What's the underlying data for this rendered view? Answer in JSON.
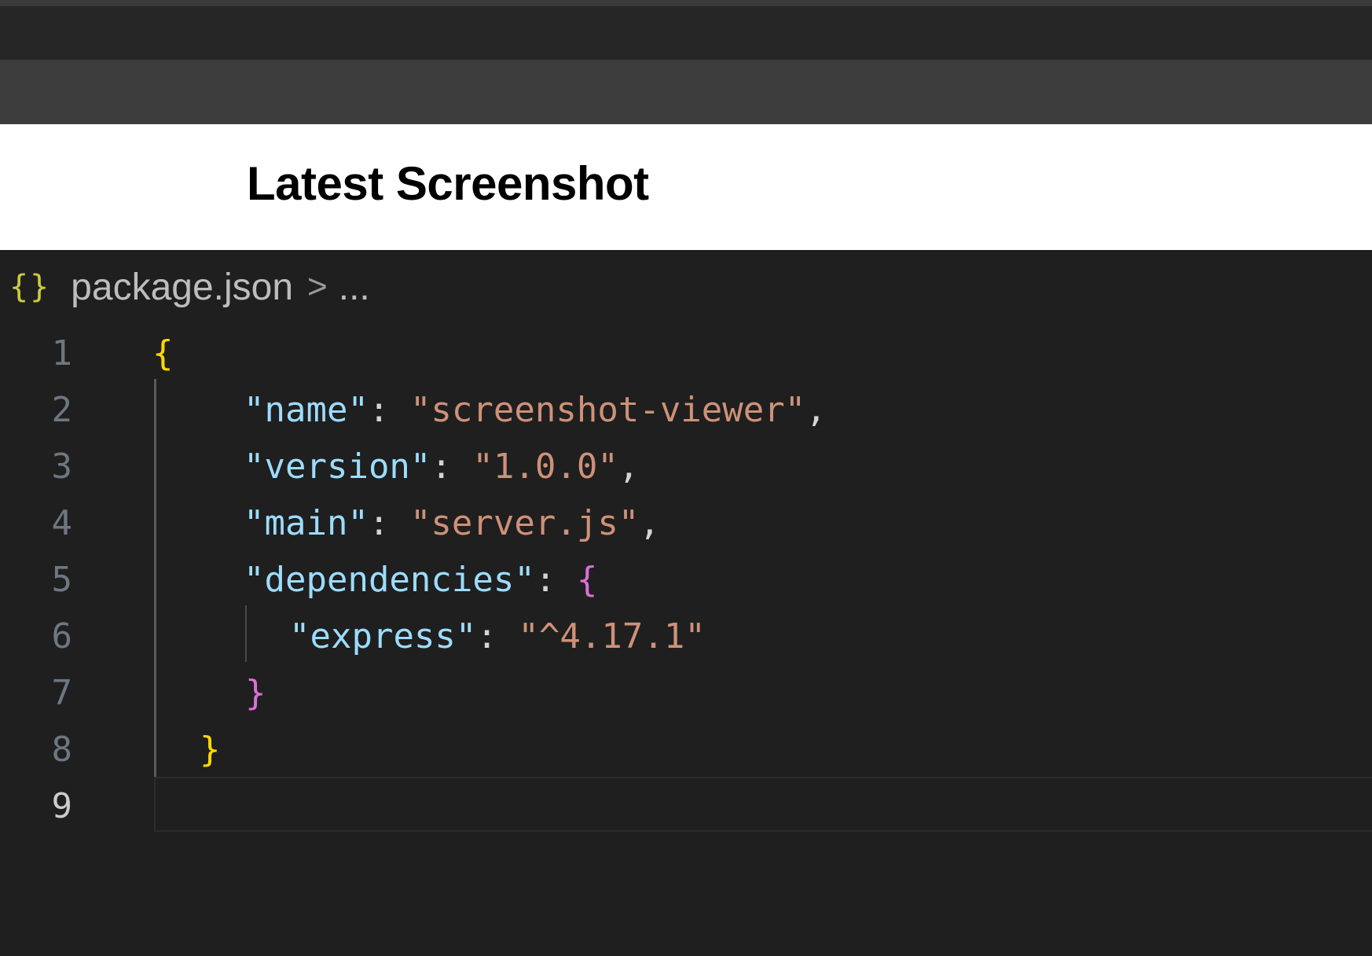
{
  "heading": "Latest Screenshot",
  "breadcrumb": {
    "icon": "json-braces-icon",
    "icon_glyph": "{}",
    "file": "package.json",
    "separator": ">",
    "ellipsis": "..."
  },
  "editor": {
    "active_line": 9,
    "lines": [
      {
        "number": "1",
        "text": "{"
      },
      {
        "number": "2",
        "text": "\"name\": \"screenshot-viewer\","
      },
      {
        "number": "3",
        "text": "\"version\": \"1.0.0\","
      },
      {
        "number": "4",
        "text": "\"main\": \"server.js\","
      },
      {
        "number": "5",
        "text": "\"dependencies\": {"
      },
      {
        "number": "6",
        "text": "\"express\": \"^4.17.1\""
      },
      {
        "number": "7",
        "text": "}"
      },
      {
        "number": "8",
        "text": "}"
      },
      {
        "number": "9",
        "text": ""
      }
    ],
    "tokens": {
      "l1_open": "{",
      "l2_key": "\"name\"",
      "l2_colon": ": ",
      "l2_val": "\"screenshot-viewer\"",
      "l2_comma": ",",
      "l3_key": "\"version\"",
      "l3_colon": ": ",
      "l3_val": "\"1.0.0\"",
      "l3_comma": ",",
      "l4_key": "\"main\"",
      "l4_colon": ": ",
      "l4_val": "\"server.js\"",
      "l4_comma": ",",
      "l5_key": "\"dependencies\"",
      "l5_colon": ": ",
      "l5_open": "{",
      "l6_key": "\"express\"",
      "l6_colon": ": ",
      "l6_val": "\"^4.17.1\"",
      "l7_close": "}",
      "l8_close": "}"
    }
  },
  "colors": {
    "key": "#9cdcfe",
    "string": "#ce9178",
    "bracket_level1": "#ffd700",
    "bracket_level2": "#da70d6",
    "background": "#1f1f1f"
  }
}
